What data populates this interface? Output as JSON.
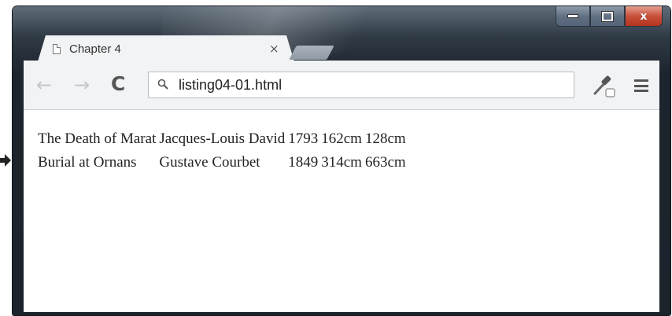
{
  "window": {
    "controls": {
      "minimize": "minimize",
      "maximize": "maximize",
      "close": "x"
    }
  },
  "tab": {
    "title": "Chapter 4",
    "close_label": "×"
  },
  "toolbar": {
    "back_icon": "arrow-left-icon",
    "forward_icon": "arrow-right-icon",
    "reload_label": "C",
    "url": "listing04-01.html",
    "tool_icon": "eyedropper-icon",
    "menu_icon": "hamburger-menu-icon"
  },
  "page": {
    "table": {
      "rows": [
        [
          "The Death of Marat",
          "Jacques-Louis David",
          "1793",
          "162cm",
          "128cm"
        ],
        [
          "Burial at Ornans",
          "Gustave Courbet",
          "1849",
          "314cm",
          "663cm"
        ]
      ]
    }
  },
  "colors": {
    "frame": "#1c242d",
    "close_button": "#c8503a",
    "tab_background": "#f2f3f5"
  }
}
